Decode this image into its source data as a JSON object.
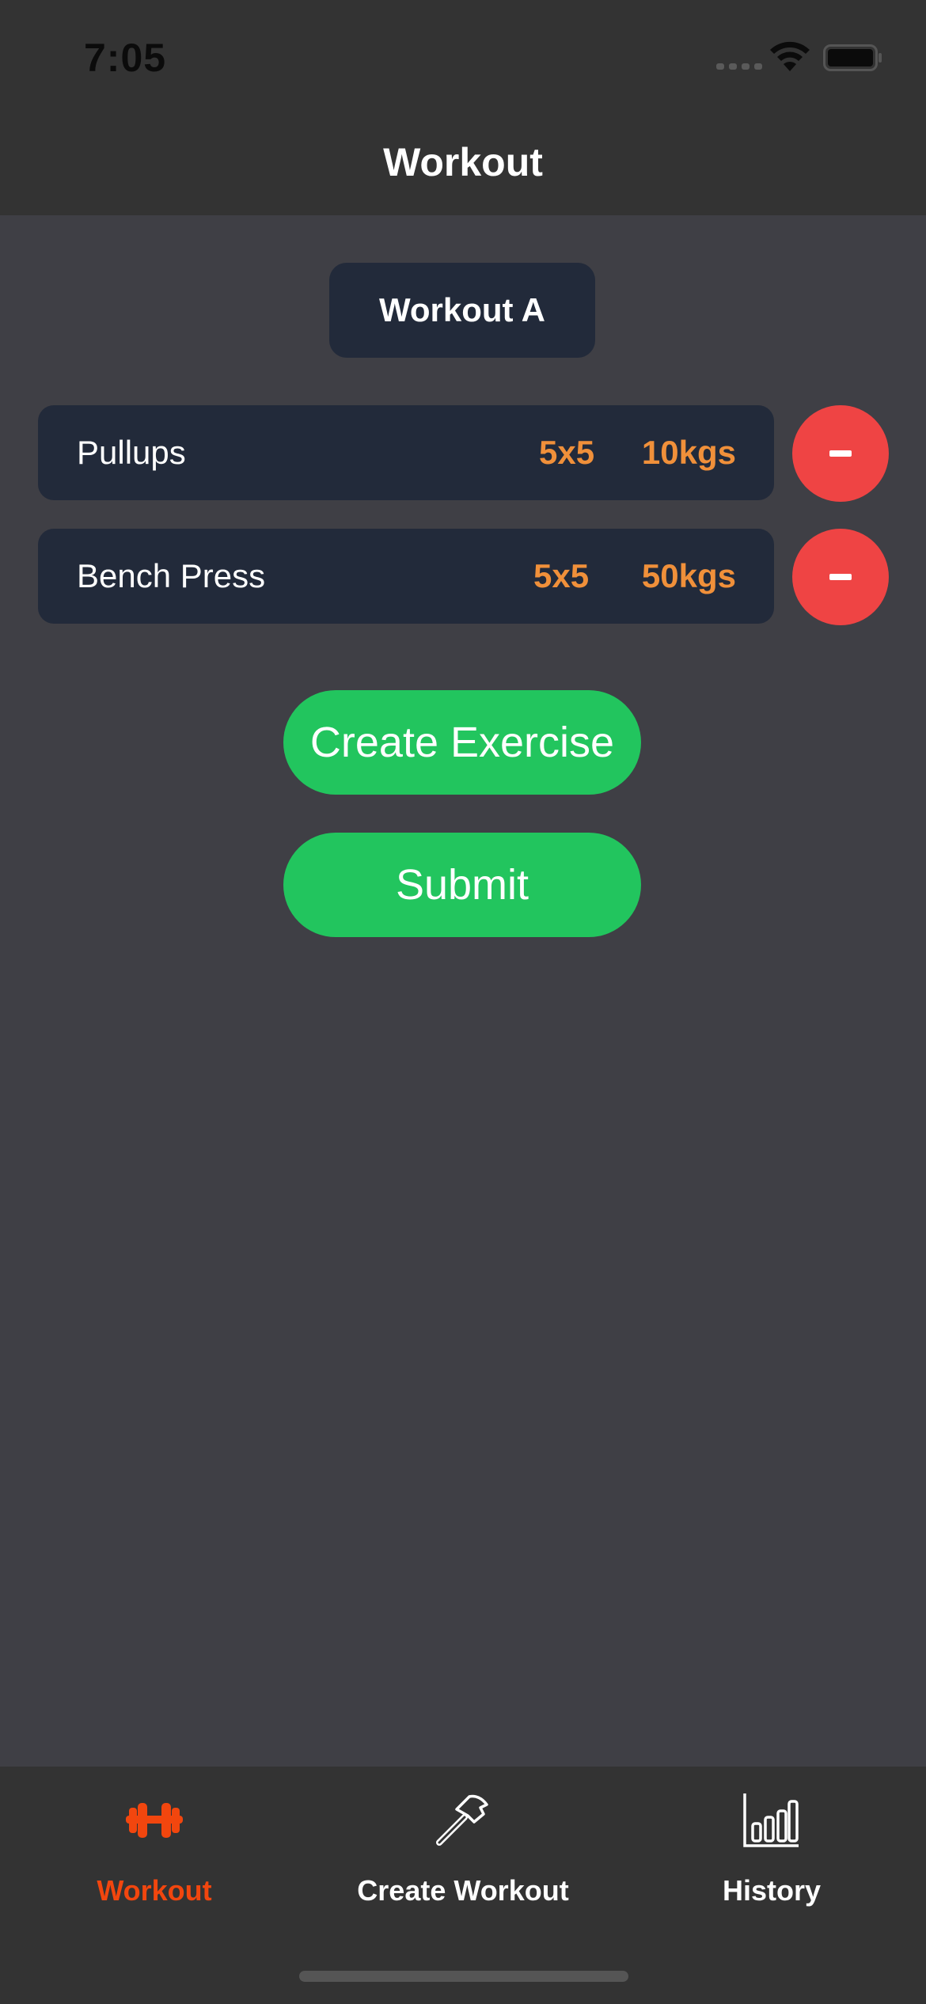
{
  "status_bar": {
    "time": "7:05"
  },
  "header": {
    "title": "Workout"
  },
  "workout": {
    "name": "Workout A"
  },
  "exercises": [
    {
      "name": "Pullups",
      "sets": "5x5",
      "weight": "10kgs"
    },
    {
      "name": "Bench Press",
      "sets": "5x5",
      "weight": "50kgs"
    }
  ],
  "actions": {
    "create_exercise_label": "Create Exercise",
    "submit_label": "Submit"
  },
  "tabbar": {
    "tabs": [
      {
        "label": "Workout",
        "icon": "dumbbell-icon",
        "active": true
      },
      {
        "label": "Create Workout",
        "icon": "hammer-icon",
        "active": false
      },
      {
        "label": "History",
        "icon": "bar-chart-icon",
        "active": false
      }
    ]
  },
  "colors": {
    "background": "#3f3f45",
    "header": "#333333",
    "card": "#222a3a",
    "accent_orange": "#f0903a",
    "remove_red": "#ef4444",
    "action_green": "#22c55e",
    "active_tab": "#f2460e"
  }
}
